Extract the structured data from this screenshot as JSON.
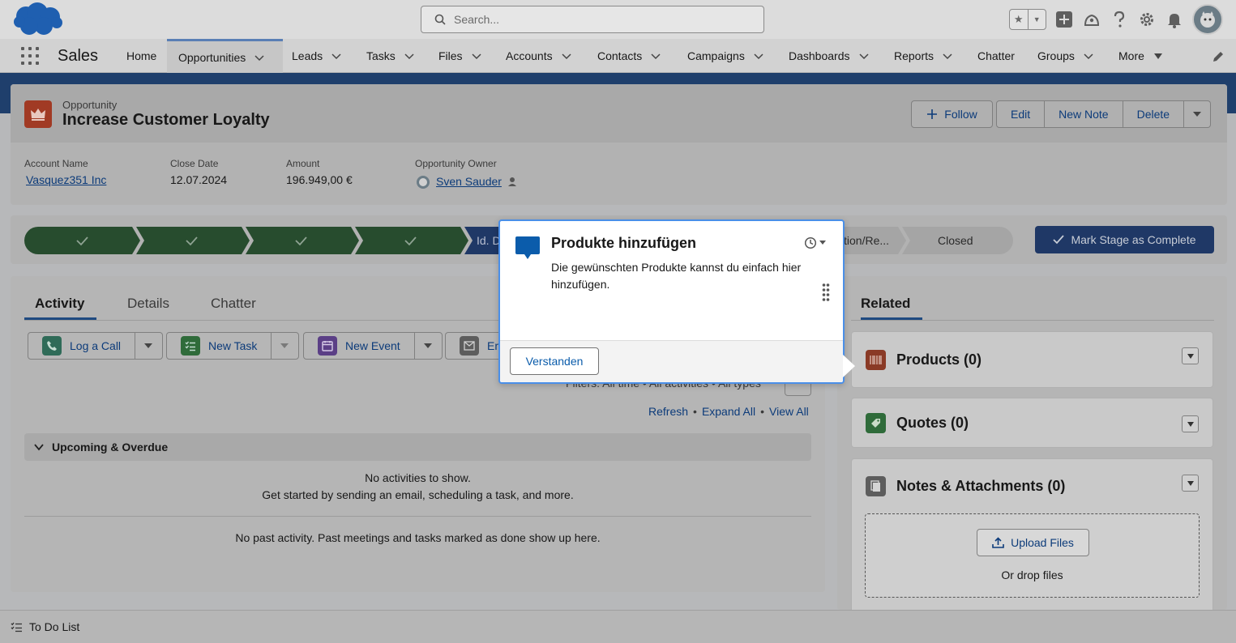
{
  "header": {
    "search_placeholder": "Search...",
    "icons": [
      "favorites-star-icon",
      "favorites-dropdown-icon",
      "global-actions-add-icon",
      "trailhead-guidance-icon",
      "help-icon",
      "setup-gear-icon",
      "notifications-bell-icon",
      "user-avatar"
    ]
  },
  "nav": {
    "app_name": "Sales",
    "items": [
      {
        "label": "Home"
      },
      {
        "label": "Opportunities"
      },
      {
        "label": "Leads"
      },
      {
        "label": "Tasks"
      },
      {
        "label": "Files"
      },
      {
        "label": "Accounts"
      },
      {
        "label": "Contacts"
      },
      {
        "label": "Campaigns"
      },
      {
        "label": "Dashboards"
      },
      {
        "label": "Reports"
      },
      {
        "label": "Chatter"
      },
      {
        "label": "Groups"
      },
      {
        "label": "More"
      }
    ]
  },
  "record": {
    "type": "Opportunity",
    "title": "Increase Customer Loyalty",
    "buttons": {
      "follow": "Follow",
      "edit": "Edit",
      "new_note": "New Note",
      "delete": "Delete"
    },
    "fields": [
      {
        "label": "Account Name",
        "value": "Vasquez351 Inc"
      },
      {
        "label": "Close Date",
        "value": "12.07.2024"
      },
      {
        "label": "Amount",
        "value": "196.949,00 €"
      },
      {
        "label": "Opportunity Owner",
        "value": "Sven Sauder"
      }
    ]
  },
  "path": {
    "current_partial": "Id. D",
    "next_partial": "tion/Re...",
    "closed": "Closed",
    "mark_button": "Mark Stage as Complete"
  },
  "activity": {
    "tabs": [
      "Activity",
      "Details",
      "Chatter"
    ],
    "publisher": [
      "Log a Call",
      "New Task",
      "New Event",
      "Em"
    ],
    "filters": "Filters: All time • All activities • All types",
    "links": [
      "Refresh",
      "Expand All",
      "View All"
    ],
    "section": "Upcoming & Overdue",
    "empty_line1": "No activities to show.",
    "empty_line2": "Get started by sending an email, scheduling a task, and more.",
    "past": "No past activity. Past meetings and tasks marked as done show up here."
  },
  "related": {
    "tab": "Related",
    "cards": [
      {
        "title": "Products (0)",
        "color": "#8a3a26"
      },
      {
        "title": "Quotes (0)",
        "color": "#2f6b3a"
      },
      {
        "title": "Notes & Attachments (0)",
        "color": "#5d5d5d"
      }
    ],
    "upload_button": "Upload Files",
    "drop_text": "Or drop files"
  },
  "utility": {
    "todo": "To Do List"
  },
  "popover": {
    "title": "Produkte hinzufügen",
    "body": "Die gewünschten Produkte kannst du einfach hier hinzufügen.",
    "button": "Verstanden"
  },
  "colors": {
    "accent": "#4a8fe8",
    "stage_done": "#274c2e",
    "stage_current": "#1f3866"
  }
}
